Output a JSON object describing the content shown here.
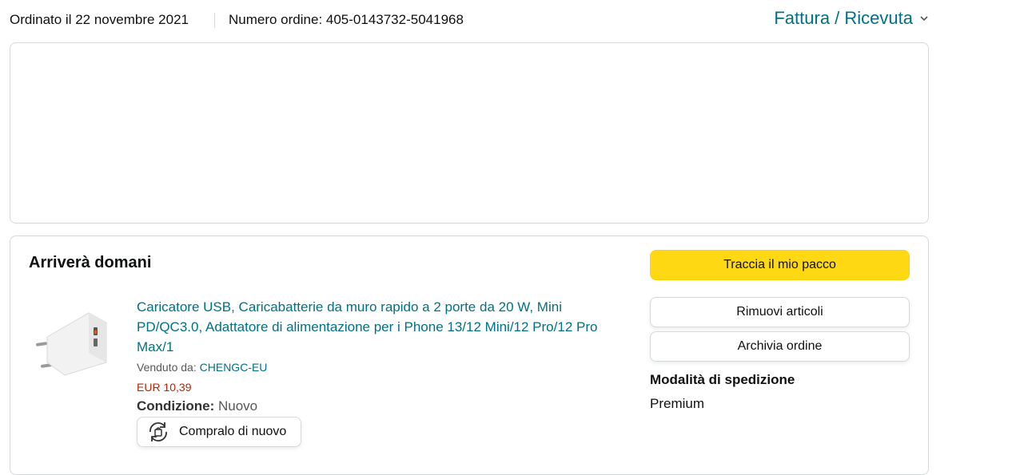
{
  "header": {
    "order_date": "Ordinato il 22 novembre 2021",
    "order_number": "Numero ordine: 405-0143732-5041968",
    "invoice_link": "Fattura / Ricevuta"
  },
  "shipment": {
    "delivery_status": "Arriverà domani",
    "product": {
      "title": "Caricatore USB, Caricabatterie da muro rapido a 2 porte da 20 W, Mini PD/QC3.0, Adattatore di alimentazione per i Phone 13/12 Mini/12 Pro/12 Pro Max/1",
      "sold_by_label": "Venduto da:",
      "seller": "CHENGC-EU",
      "price": "EUR 10,39",
      "condition_label": "Condizione:",
      "condition_value": "Nuovo",
      "buy_again_label": "Compralo di nuovo"
    },
    "actions": {
      "track": "Traccia il mio pacco",
      "remove": "Rimuovi articoli",
      "archive": "Archivia ordine"
    },
    "shipping_method_title": "Modalità di spedizione",
    "shipping_method_value": "Premium"
  },
  "colors": {
    "link": "#007185",
    "price": "#B12704",
    "primary_button": "#FFD814",
    "border": "#D5D9D9"
  }
}
